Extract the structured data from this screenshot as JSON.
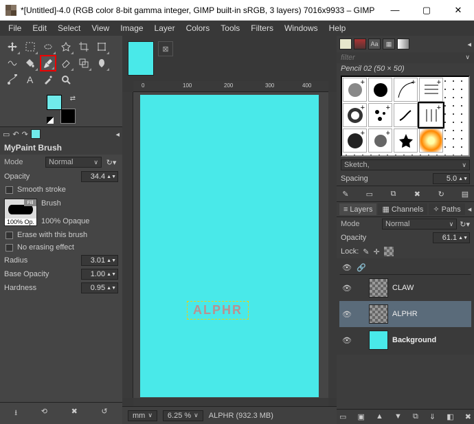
{
  "title": "*[Untitled]-4.0 (RGB color 8-bit gamma integer, GIMP built-in sRGB, 3 layers) 7016x9933 – GIMP",
  "menus": [
    "File",
    "Edit",
    "Select",
    "View",
    "Image",
    "Layer",
    "Colors",
    "Tools",
    "Filters",
    "Windows",
    "Help"
  ],
  "tool_options": {
    "title": "MyPaint Brush",
    "mode_label": "Mode",
    "mode_value": "Normal",
    "opacity_label": "Opacity",
    "opacity_value": "34.4",
    "smooth_stroke": "Smooth stroke",
    "brush_label": "Brush",
    "brush_caption": "100% Opaque",
    "brush_tag": "100% Op.",
    "fill_tag": "Fill",
    "erase_with": "Erase with this brush",
    "no_erasing": "No erasing effect",
    "radius_label": "Radius",
    "radius_value": "3.01",
    "base_opacity_label": "Base Opacity",
    "base_opacity_value": "1.00",
    "hardness_label": "Hardness",
    "hardness_value": "0.95"
  },
  "ruler_marks": [
    "0",
    "100",
    "200",
    "300",
    "400"
  ],
  "canvas_text": "ALPHR",
  "status": {
    "unit": "mm",
    "zoom": "6.25 %",
    "info": "ALPHR (932.3 MB)"
  },
  "brushes": {
    "filter_placeholder": "filter",
    "name": "Pencil 02 (50 × 50)",
    "dropdown": "Sketch,",
    "spacing_label": "Spacing",
    "spacing_value": "5.0"
  },
  "layers": {
    "tabs": [
      "Layers",
      "Channels",
      "Paths"
    ],
    "mode_label": "Mode",
    "mode_value": "Normal",
    "opacity_label": "Opacity",
    "opacity_value": "61.1",
    "lock_label": "Lock:",
    "items": [
      {
        "name": "CLAW"
      },
      {
        "name": "ALPHR"
      },
      {
        "name": "Background"
      }
    ]
  }
}
